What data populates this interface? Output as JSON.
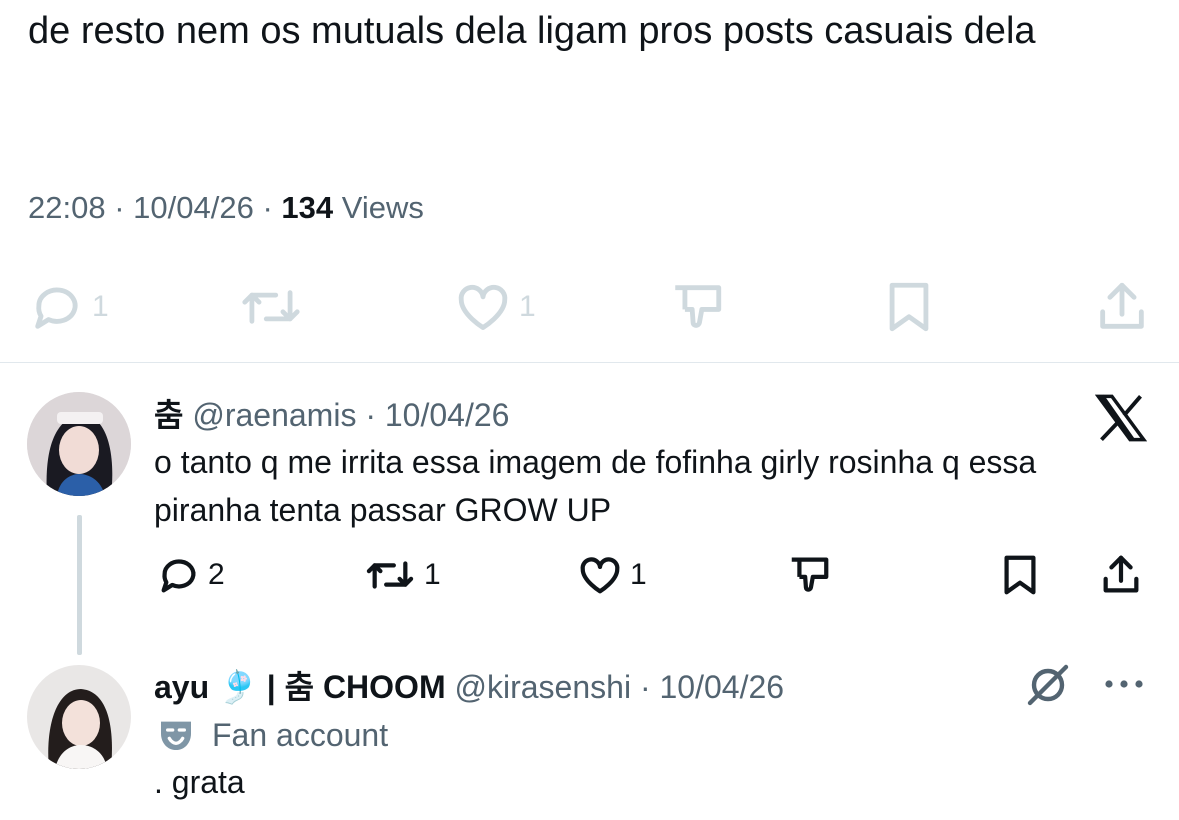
{
  "main_tweet": {
    "text": "de resto nem os mutuals dela ligam pros posts casuais dela",
    "time": "22:08",
    "date": "10/04/26",
    "sep": "·",
    "views_count": "134",
    "views_label": "Views",
    "actions": {
      "replies": "1",
      "reposts": "",
      "likes": "1"
    }
  },
  "reply_1": {
    "display_name": "춤",
    "handle": "@raenamis",
    "date": "10/04/26",
    "sep": "·",
    "text": "o tanto q me irrita essa imagem de fofinha girly rosinha q essa piranha tenta passar GROW UP",
    "actions": {
      "replies": "2",
      "reposts": "1",
      "likes": "1"
    }
  },
  "reply_2": {
    "display_name": "ayu 🎐 | 춤 CHOOM",
    "handle": "@kirasenshi",
    "date": "10/04/26",
    "sep": "·",
    "label": "Fan account",
    "text": ". grata"
  },
  "icons": [
    "reply-icon",
    "repost-icon",
    "like-icon",
    "dislike-icon",
    "bookmark-icon",
    "share-icon",
    "x-logo-icon",
    "grok-icon",
    "more-icon",
    "fan-mask-icon"
  ],
  "colors": {
    "text": "#0f1419",
    "muted": "#536471",
    "faded": "#cfd9de",
    "divider": "#e1e8ed"
  }
}
